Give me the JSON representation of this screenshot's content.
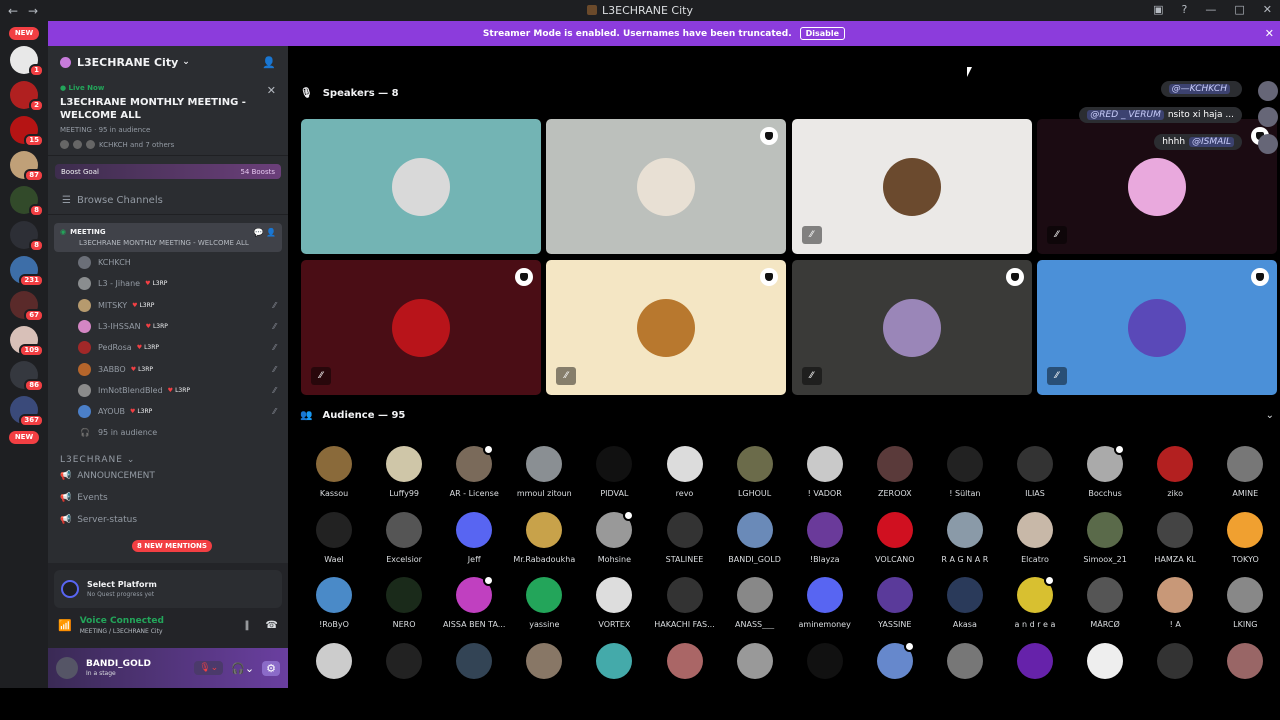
{
  "window": {
    "title": "L3ECHRANE City",
    "back": "←",
    "forward": "→"
  },
  "guild_badges": [
    "NEW",
    "1",
    "2",
    "15",
    "87",
    "8",
    "8",
    "231",
    "67",
    "109",
    "86",
    "367",
    "NEW"
  ],
  "banner": {
    "text": "Streamer Mode is enabled. Usernames have been truncated.",
    "button": "Disable"
  },
  "server": {
    "name": "L3ECHRANE City"
  },
  "live": {
    "label": "Live Now",
    "title": "L3ECHRANE MONTHLY MEETING - WELCOME ALL",
    "category": "MEETING",
    "audience": "95 in audience",
    "others": "KCHKCH and 7 others"
  },
  "boost": {
    "label": "Boost Goal",
    "count": "54 Boosts"
  },
  "browse": "Browse Channels",
  "stage_channel": {
    "name": "MEETING",
    "subtitle": "L3ECHRANE MONTHLY MEETING - WELCOME ALL"
  },
  "members": [
    {
      "name": "KCHKCH",
      "tag": "",
      "color": "#6b6f78"
    },
    {
      "name": "L3 - Jihane",
      "tag": "L3RP",
      "color": "#8a8d8f"
    },
    {
      "name": "MITSKY",
      "tag": "L3RP",
      "color": "#b69a6e"
    },
    {
      "name": "L3-IHSSAN",
      "tag": "L3RP",
      "color": "#d486c4"
    },
    {
      "name": "PedRosa",
      "tag": "L3RP",
      "color": "#a12828"
    },
    {
      "name": "3ABBO",
      "tag": "L3RP",
      "color": "#b5652b"
    },
    {
      "name": "ImNotBlendBled",
      "tag": "L3RP",
      "color": "#8b8b8b"
    },
    {
      "name": "AYOUB",
      "tag": "L3RP",
      "color": "#4b7fc8"
    }
  ],
  "aud_line": "95 in audience",
  "category": "L3ECHRANE",
  "channels": [
    "ANNOUNCEMENT",
    "Events",
    "Server-status"
  ],
  "mentions": "8 NEW MENTIONS",
  "platform": {
    "title": "Select Platform",
    "subtitle": "No Quest progress yet"
  },
  "voice": {
    "title": "Voice Connected",
    "subtitle": "MEETING / L3ECHRANE City"
  },
  "user": {
    "name": "BANDI_GOLD",
    "status": "In a stage"
  },
  "speakers_label": "Speakers — 8",
  "audience_label": "Audience — 95",
  "speakers": [
    {
      "bg": "#73b4b4",
      "av": "#d9d9d9",
      "mod": false,
      "muted": false
    },
    {
      "bg": "#bcc0bc",
      "av": "#e8e0d4",
      "mod": true,
      "muted": false
    },
    {
      "bg": "#ebe9e7",
      "av": "#6b4a2e",
      "mod": false,
      "muted": true
    },
    {
      "bg": "#1b0b12",
      "av": "#e9a9dd",
      "mod": true,
      "muted": true
    },
    {
      "bg": "#4a0d15",
      "av": "#b8141a",
      "mod": true,
      "muted": true
    },
    {
      "bg": "#f4e6c4",
      "av": "#b8782e",
      "mod": true,
      "muted": true
    },
    {
      "bg": "#3a3a38",
      "av": "#9a86b8",
      "mod": true,
      "muted": true
    },
    {
      "bg": "#4b90d8",
      "av": "#5a49b8",
      "mod": true,
      "muted": true
    }
  ],
  "chat": [
    {
      "mention": "@—⁠KCHKCH",
      "text": ""
    },
    {
      "mention": "@RED _ VERUM",
      "text": "nsito xi haja ..."
    },
    {
      "mention": "@ISMAIL",
      "text": "hhhh"
    }
  ],
  "audience": [
    {
      "name": "Kassou",
      "c": "#8a6a3a"
    },
    {
      "name": "Luffy99",
      "c": "#cfc6a8"
    },
    {
      "name": "AR - License",
      "c": "#7a6a5a",
      "mod": true
    },
    {
      "name": "mmoul zitoun",
      "c": "#8a8f93"
    },
    {
      "name": "PIDVAL",
      "c": "#111"
    },
    {
      "name": "revo",
      "c": "#dcdcdc"
    },
    {
      "name": "LGHOUL",
      "c": "#6b6b4a"
    },
    {
      "name": "! VADOR",
      "c": "#c9c9c9"
    },
    {
      "name": "ZEROOX",
      "c": "#5a3a3a"
    },
    {
      "name": "! Sültan",
      "c": "#222"
    },
    {
      "name": "ILIAS",
      "c": "#333"
    },
    {
      "name": "Bocchus",
      "c": "#aaa",
      "mod": true
    },
    {
      "name": "ziko",
      "c": "#b32020"
    },
    {
      "name": "AMINE",
      "c": "#777"
    },
    {
      "name": "Wael",
      "c": "#222"
    },
    {
      "name": "Excelsior",
      "c": "#555"
    },
    {
      "name": "Jeff",
      "c": "#5865f2"
    },
    {
      "name": "Mr.Rabadoukha",
      "c": "#c8a24a"
    },
    {
      "name": "Mohsine",
      "c": "#999",
      "mod": true
    },
    {
      "name": "STALINEE",
      "c": "#333"
    },
    {
      "name": "BANDI_GOLD",
      "c": "#6a8ab8"
    },
    {
      "name": "!Blayza",
      "c": "#6a3a9a"
    },
    {
      "name": "VOLCANO",
      "c": "#d01020"
    },
    {
      "name": "R A G N A R",
      "c": "#8a9aa8"
    },
    {
      "name": "Elcatro",
      "c": "#c8b8a8"
    },
    {
      "name": "Simoox_21",
      "c": "#5a6a4a"
    },
    {
      "name": "HAMZA KL",
      "c": "#444"
    },
    {
      "name": "TOKYO",
      "c": "#f0a030"
    },
    {
      "name": "!RoByO",
      "c": "#4a8ac8"
    },
    {
      "name": "NERO",
      "c": "#1a2a1a"
    },
    {
      "name": "AISSA BEN TA...",
      "c": "#c040c0",
      "mod": true
    },
    {
      "name": "yassine",
      "c": "#23a55a"
    },
    {
      "name": "VORTEX",
      "c": "#ddd"
    },
    {
      "name": "HAKACHI FAS...",
      "c": "#333"
    },
    {
      "name": "ANASS___",
      "c": "#888"
    },
    {
      "name": "aminemoney",
      "c": "#5865f2"
    },
    {
      "name": "YASSINE",
      "c": "#5a3a9a"
    },
    {
      "name": "Akasa",
      "c": "#2a3a5a"
    },
    {
      "name": "a n d r e a",
      "c": "#d8c030",
      "mod": true
    },
    {
      "name": "MÃRCØ",
      "c": "#555"
    },
    {
      "name": "! A",
      "c": "#c89878"
    },
    {
      "name": "LKING",
      "c": "#888"
    },
    {
      "name": "",
      "c": "#ccc"
    },
    {
      "name": "",
      "c": "#222"
    },
    {
      "name": "",
      "c": "#345"
    },
    {
      "name": "",
      "c": "#876"
    },
    {
      "name": "",
      "c": "#4aa"
    },
    {
      "name": "",
      "c": "#a66"
    },
    {
      "name": "",
      "c": "#999"
    },
    {
      "name": "",
      "c": "#111"
    },
    {
      "name": "",
      "c": "#68c",
      "mod": true
    },
    {
      "name": "",
      "c": "#777"
    },
    {
      "name": "",
      "c": "#62a"
    },
    {
      "name": "",
      "c": "#eee"
    },
    {
      "name": "",
      "c": "#333"
    },
    {
      "name": "",
      "c": "#966"
    }
  ]
}
